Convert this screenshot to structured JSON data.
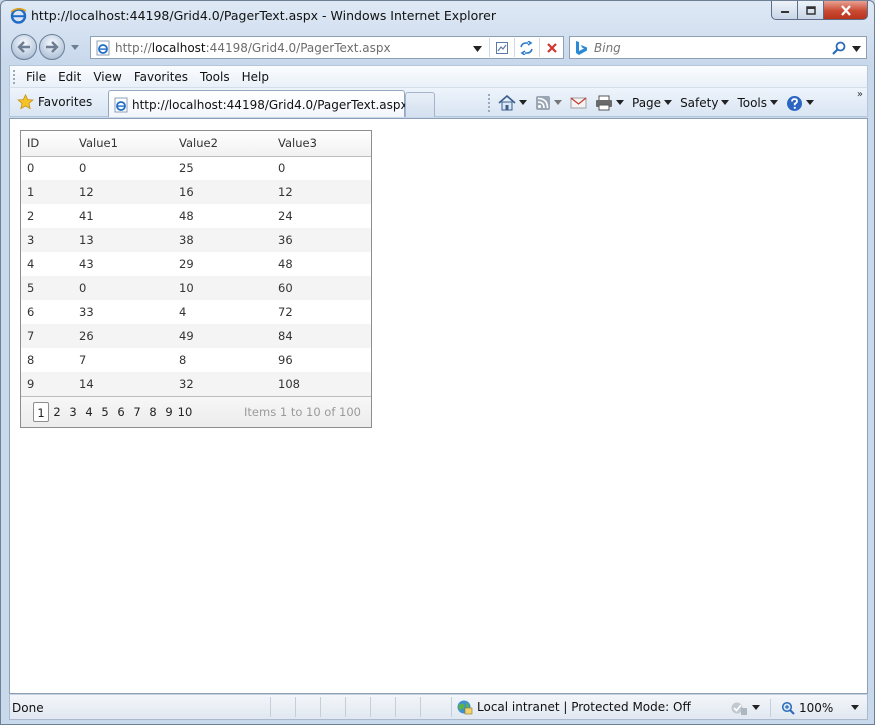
{
  "window": {
    "title": "http://localhost:44198/Grid4.0/PagerText.aspx - Windows Internet Explorer"
  },
  "address": {
    "url_prefix": "http://",
    "url_host": "localhost",
    "url_rest": ":44198/Grid4.0/PagerText.aspx"
  },
  "search": {
    "placeholder": "Bing"
  },
  "menu": {
    "items": [
      "File",
      "Edit",
      "View",
      "Favorites",
      "Tools",
      "Help"
    ]
  },
  "favorites": {
    "label": "Favorites"
  },
  "tab": {
    "label": "http://localhost:44198/Grid4.0/PagerText.aspx"
  },
  "commands": {
    "page": "Page",
    "safety": "Safety",
    "tools": "Tools"
  },
  "grid": {
    "columns": [
      "ID",
      "Value1",
      "Value2",
      "Value3"
    ],
    "rows": [
      [
        "0",
        "0",
        "25",
        "0"
      ],
      [
        "1",
        "12",
        "16",
        "12"
      ],
      [
        "2",
        "41",
        "48",
        "24"
      ],
      [
        "3",
        "13",
        "38",
        "36"
      ],
      [
        "4",
        "43",
        "29",
        "48"
      ],
      [
        "5",
        "0",
        "10",
        "60"
      ],
      [
        "6",
        "33",
        "4",
        "72"
      ],
      [
        "7",
        "26",
        "49",
        "84"
      ],
      [
        "8",
        "7",
        "8",
        "96"
      ],
      [
        "9",
        "14",
        "32",
        "108"
      ]
    ],
    "pager": {
      "pages": [
        "1",
        "2",
        "3",
        "4",
        "5",
        "6",
        "7",
        "8",
        "9",
        "10"
      ],
      "current": "1",
      "info": "Items 1 to 10 of 100"
    }
  },
  "status": {
    "text": "Done",
    "zone": "Local intranet | Protected Mode: Off",
    "zoom": "100%"
  },
  "colors": {
    "accent": "#1f6cc6",
    "close_button": "#c94a32",
    "alt_row": "#f4f4f4"
  },
  "icons": [
    "ie-icon",
    "back-icon",
    "forward-icon",
    "compat-view-icon",
    "refresh-icon",
    "stop-icon",
    "bing-icon",
    "search-go-icon",
    "favorites-star-icon",
    "home-icon",
    "feeds-icon",
    "mail-icon",
    "print-icon",
    "help-icon",
    "globe-icon",
    "zoom-icon"
  ]
}
